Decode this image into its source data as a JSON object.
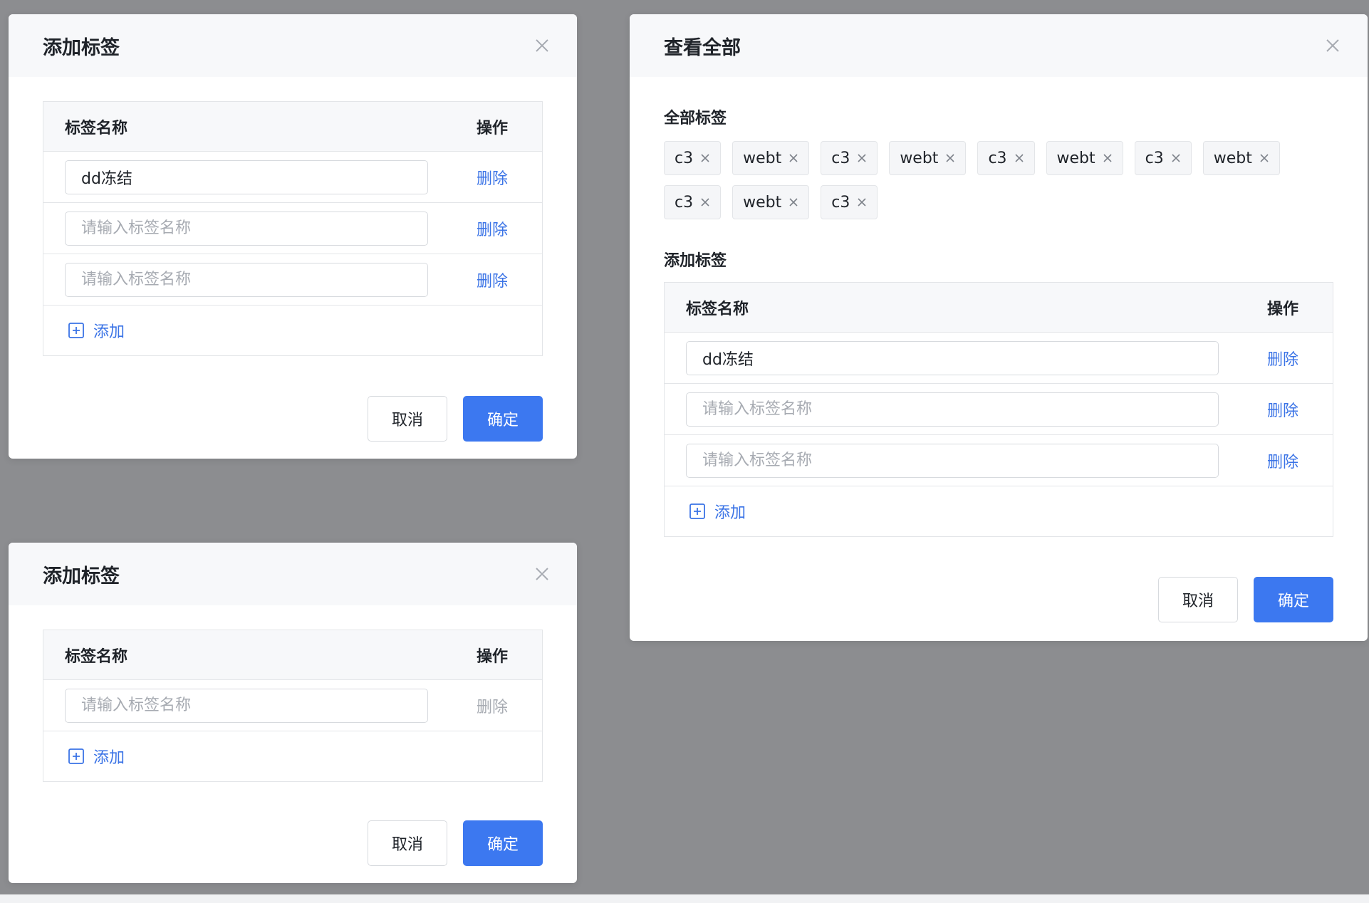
{
  "dialog1": {
    "title": "添加标签",
    "col_name": "标签名称",
    "col_op": "操作",
    "rows": [
      {
        "value": "dd冻结",
        "placeholder": "请输入标签名称",
        "delete": "删除"
      },
      {
        "value": "",
        "placeholder": "请输入标签名称",
        "delete": "删除"
      },
      {
        "value": "",
        "placeholder": "请输入标签名称",
        "delete": "删除"
      }
    ],
    "add_label": "添加",
    "cancel_label": "取消",
    "ok_label": "确定"
  },
  "dialog2": {
    "title": "添加标签",
    "col_name": "标签名称",
    "col_op": "操作",
    "rows": [
      {
        "value": "",
        "placeholder": "请输入标签名称",
        "delete": "删除"
      }
    ],
    "add_label": "添加",
    "cancel_label": "取消",
    "ok_label": "确定"
  },
  "dialog3": {
    "title": "查看全部",
    "all_tags_label": "全部标签",
    "tags": [
      "c3",
      "webt",
      "c3",
      "webt",
      "c3",
      "webt",
      "c3",
      "webt",
      "c3",
      "webt",
      "c3"
    ],
    "add_tags_label": "添加标签",
    "col_name": "标签名称",
    "col_op": "操作",
    "rows": [
      {
        "value": "dd冻结",
        "placeholder": "请输入标签名称",
        "delete": "删除"
      },
      {
        "value": "",
        "placeholder": "请输入标签名称",
        "delete": "删除"
      },
      {
        "value": "",
        "placeholder": "请输入标签名称",
        "delete": "删除"
      }
    ],
    "add_label": "添加",
    "cancel_label": "取消",
    "ok_label": "确定"
  },
  "colors": {
    "primary": "#3c78f0",
    "link": "#3a73e6",
    "backdrop": "#8c8d90"
  }
}
